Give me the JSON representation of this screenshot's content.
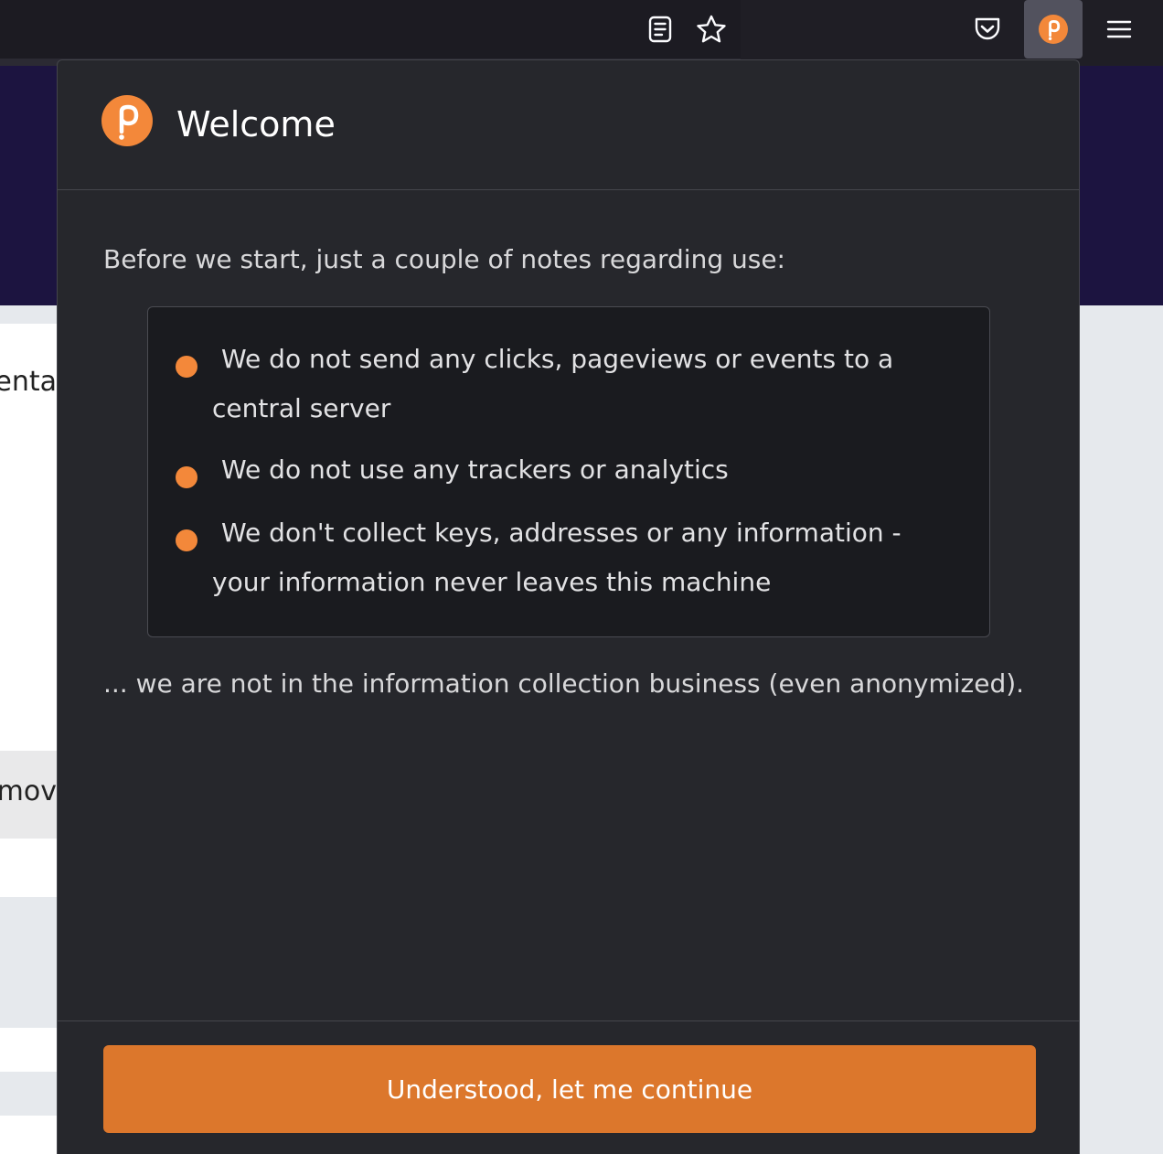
{
  "toolbar": {
    "icons": [
      "reader-view-icon",
      "bookmark-star-icon",
      "pocket-icon",
      "polkadot-extension-icon",
      "hamburger-menu-icon"
    ]
  },
  "background_page": {
    "fragment_1": "enta",
    "fragment_2": "emov"
  },
  "popup": {
    "title": "Welcome",
    "intro": "Before we start, just a couple of notes regarding use:",
    "notes": [
      {
        "line1": "We do not send any clicks, pageviews or events to a",
        "line2": "central server"
      },
      {
        "line1": "We do not use any trackers or analytics"
      },
      {
        "line1": "We don't collect keys, addresses or any information -",
        "line2": "your information never leaves this machine"
      }
    ],
    "outro": "... we are not in the information collection business (even anonymized).",
    "continue_label": "Understood, let me continue"
  },
  "colors": {
    "accent": "#dc772c",
    "bullet": "#f3883a",
    "popup_bg": "#26272c",
    "notes_bg": "#1a1b1f",
    "banner": "#1c1440"
  }
}
